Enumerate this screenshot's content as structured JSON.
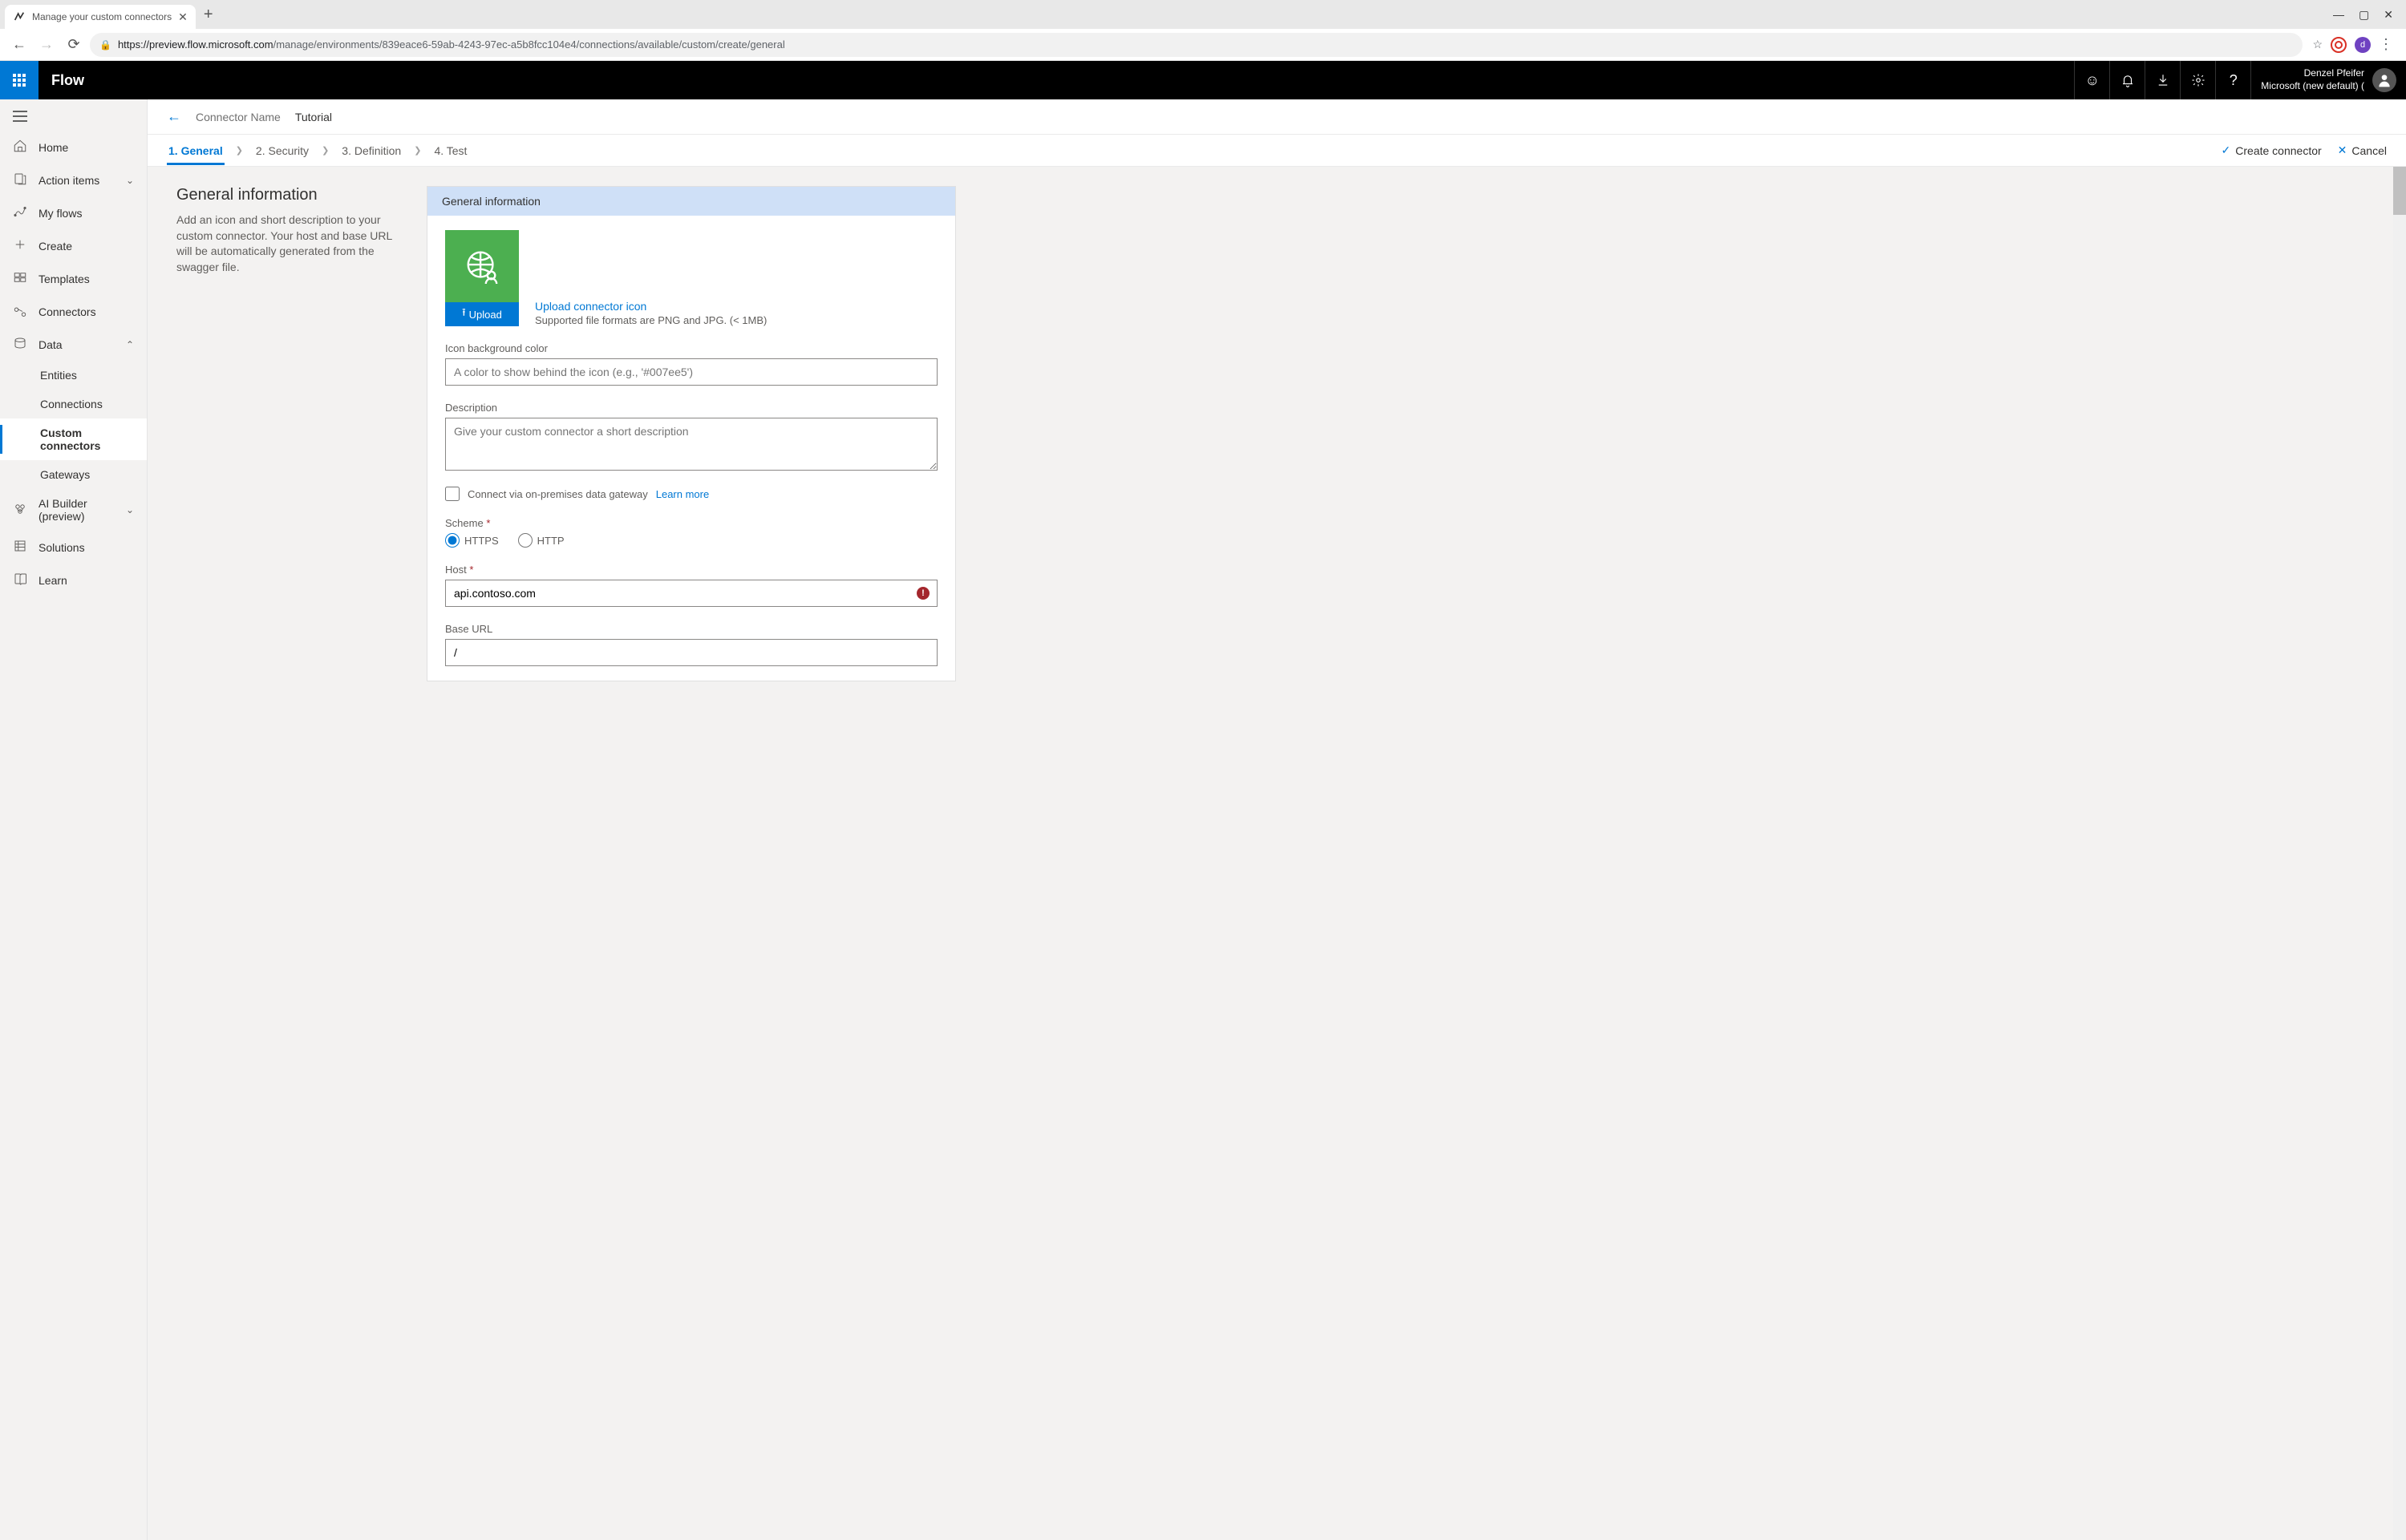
{
  "browser": {
    "tab_title": "Manage your custom connectors",
    "url_secure": "https://",
    "url_host": "preview.flow.microsoft.com",
    "url_path": "/manage/environments/839eace6-59ab-4243-97ec-a5b8fcc104e4/connections/available/custom/create/general",
    "avatar_letter": "d"
  },
  "app": {
    "name": "Flow",
    "user_name": "Denzel Pfeifer",
    "user_env": "Microsoft (new default) ("
  },
  "sidebar": {
    "items": [
      {
        "label": "Home"
      },
      {
        "label": "Action items",
        "chev": true,
        "dir": "down"
      },
      {
        "label": "My flows"
      },
      {
        "label": "Create"
      },
      {
        "label": "Templates"
      },
      {
        "label": "Connectors"
      },
      {
        "label": "Data",
        "chev": true,
        "dir": "up"
      },
      {
        "label": "Entities",
        "sub": true
      },
      {
        "label": "Connections",
        "sub": true
      },
      {
        "label": "Custom connectors",
        "sub": true,
        "active": true
      },
      {
        "label": "Gateways",
        "sub": true
      },
      {
        "label": "AI Builder (preview)",
        "chev": true,
        "dir": "down"
      },
      {
        "label": "Solutions"
      },
      {
        "label": "Learn"
      }
    ]
  },
  "crumb": {
    "label": "Connector Name",
    "value": "Tutorial"
  },
  "wizard": {
    "steps": [
      "1. General",
      "2. Security",
      "3. Definition",
      "4. Test"
    ],
    "active_index": 0,
    "create_label": "Create connector",
    "cancel_label": "Cancel"
  },
  "left": {
    "heading": "General information",
    "body": "Add an icon and short description to your custom connector. Your host and base URL will be automatically generated from the swagger file."
  },
  "card": {
    "header": "General information",
    "upload_btn": "Upload",
    "upload_link": "Upload connector icon",
    "upload_hint": "Supported file formats are PNG and JPG. (< 1MB)",
    "bg_label": "Icon background color",
    "bg_placeholder": "A color to show behind the icon (e.g., '#007ee5')",
    "bg_value": "",
    "desc_label": "Description",
    "desc_placeholder": "Give your custom connector a short description",
    "desc_value": "",
    "gateway_label": "Connect via on-premises data gateway",
    "learn_more": "Learn more",
    "scheme_label": "Scheme",
    "scheme_https": "HTTPS",
    "scheme_http": "HTTP",
    "scheme_selected": "HTTPS",
    "host_label": "Host",
    "host_value": "api.contoso.com",
    "baseurl_label": "Base URL",
    "baseurl_value": "/"
  }
}
